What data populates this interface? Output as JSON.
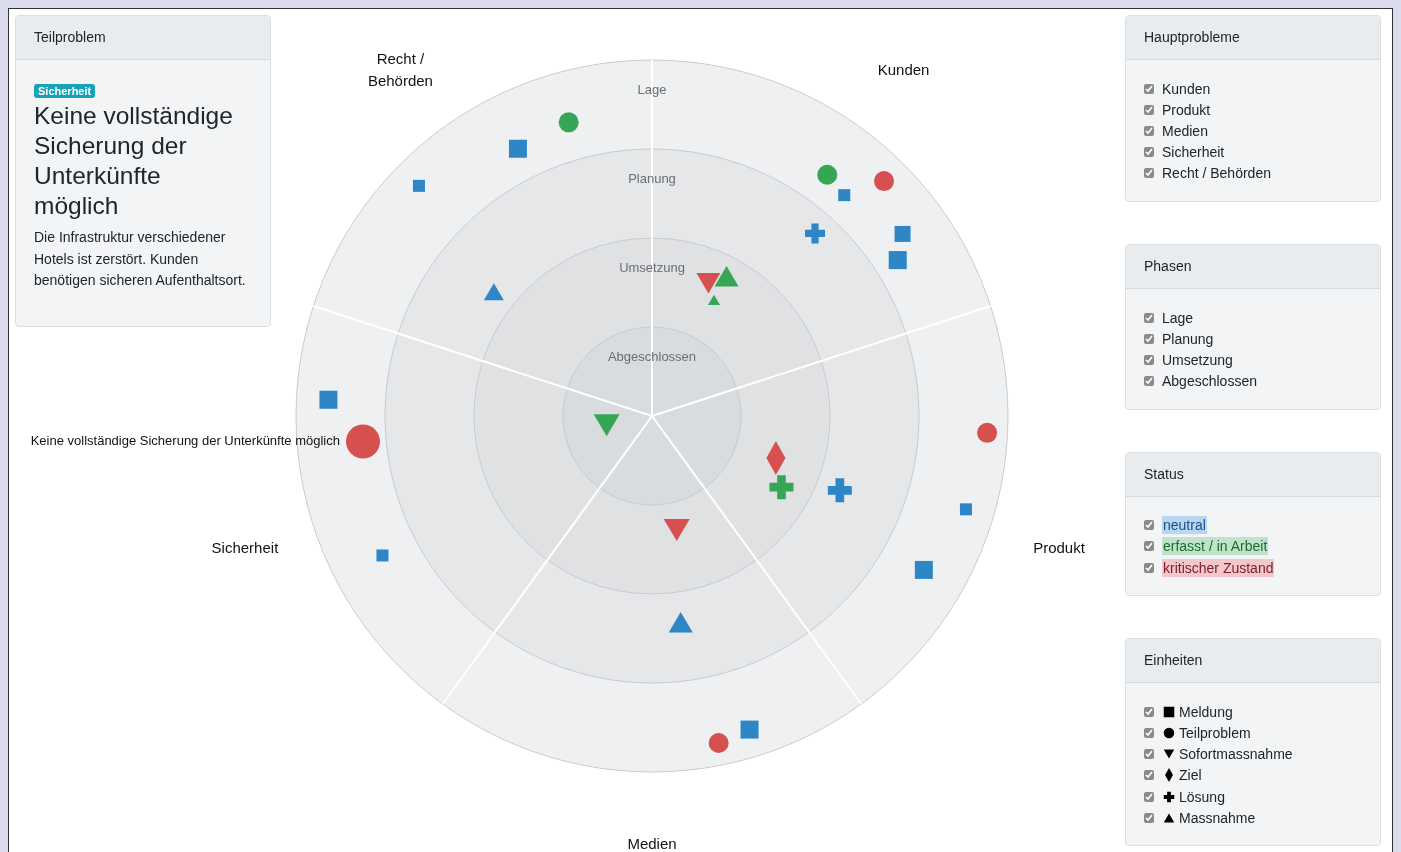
{
  "left_card": {
    "header": "Teilproblem",
    "badge": "Sicherheit",
    "title": "Keine vollständige Sicherung der Unterkünfte möglich",
    "description": "Die Infrastruktur verschiedener Hotels ist zerstört. Kunden benötigen sicheren Aufenthaltsort."
  },
  "radar": {
    "rings": [
      {
        "label": "Lage"
      },
      {
        "label": "Planung"
      },
      {
        "label": "Umsetzung"
      },
      {
        "label": "Abgeschlossen"
      }
    ],
    "sectors": [
      {
        "label": "Kunden",
        "lage": [
          {
            "kind": "circle",
            "color": "#35a655"
          },
          {
            "kind": "circle",
            "color": "#d6504f"
          },
          {
            "kind": "square",
            "color": "#2f86c6"
          },
          {
            "kind": "square",
            "color": "#2f86c6"
          },
          {
            "kind": "square",
            "color": "#2f86c6"
          }
        ],
        "planung": [
          {
            "kind": "cross",
            "color": "#2f86c6"
          }
        ],
        "umsetzung": [
          {
            "kind": "down-triangle",
            "color": "#d6504f"
          },
          {
            "kind": "triangle",
            "color": "#35a655"
          },
          {
            "kind": "triangle",
            "color": "#35a655"
          }
        ]
      },
      {
        "label": "Produkt",
        "lage": [
          {
            "kind": "circle",
            "color": "#d6504f"
          },
          {
            "kind": "square",
            "color": "#2f86c6"
          },
          {
            "kind": "square",
            "color": "#2f86c6"
          }
        ],
        "planung": [
          {
            "kind": "cross",
            "color": "#2f86c6"
          }
        ],
        "umsetzung": [
          {
            "kind": "diamond",
            "color": "#d6504f"
          },
          {
            "kind": "cross",
            "color": "#35a655"
          }
        ]
      },
      {
        "label": "Medien",
        "lage": [
          {
            "kind": "circle",
            "color": "#d6504f"
          },
          {
            "kind": "square",
            "color": "#2f86c6"
          }
        ],
        "planung": [
          {
            "kind": "triangle",
            "color": "#2f86c6"
          }
        ],
        "umsetzung": [
          {
            "kind": "down-triangle",
            "color": "#d6504f"
          }
        ]
      },
      {
        "label": "Sicherheit",
        "lage": [
          {
            "kind": "square",
            "color": "#2f86c6"
          },
          {
            "kind": "circle",
            "color": "#d6504f",
            "label": "Keine vollständige Sicherung der Unterkünfte möglich"
          },
          {
            "kind": "square",
            "color": "#2f86c6"
          }
        ],
        "abgeschlossen": [
          {
            "kind": "down-triangle",
            "color": "#35a655"
          }
        ]
      },
      {
        "label": "Recht / Behörden",
        "lage": [
          {
            "kind": "circle",
            "color": "#35a655"
          },
          {
            "kind": "square",
            "color": "#2f86c6"
          },
          {
            "kind": "square",
            "color": "#2f86c6"
          }
        ],
        "planung": [
          {
            "kind": "triangle",
            "color": "#2f86c6"
          }
        ]
      }
    ]
  },
  "filters": [
    {
      "header": "Hauptprobleme",
      "items": [
        {
          "label": "Kunden",
          "checked": true
        },
        {
          "label": "Produkt",
          "checked": true
        },
        {
          "label": "Medien",
          "checked": true
        },
        {
          "label": "Sicherheit",
          "checked": true
        },
        {
          "label": "Recht / Behörden",
          "checked": true
        }
      ]
    },
    {
      "header": "Phasen",
      "items": [
        {
          "label": "Lage",
          "checked": true
        },
        {
          "label": "Planung",
          "checked": true
        },
        {
          "label": "Umsetzung",
          "checked": true
        },
        {
          "label": "Abgeschlossen",
          "checked": true
        }
      ]
    },
    {
      "header": "Status",
      "items": [
        {
          "label": "neutral",
          "checked": true,
          "color": "#b8d7f3"
        },
        {
          "label": "erfasst / in Arbeit",
          "checked": true,
          "color": "#c0e4cb"
        },
        {
          "label": "kritischer Zustand",
          "checked": true,
          "color": "#f3c7cb"
        }
      ]
    },
    {
      "header": "Einheiten",
      "items": [
        {
          "label": "Meldung",
          "checked": true,
          "kind": "square"
        },
        {
          "label": "Teilproblem",
          "checked": true,
          "kind": "circle"
        },
        {
          "label": "Sofortmassnahme",
          "checked": true,
          "kind": "down-triangle"
        },
        {
          "label": "Ziel",
          "checked": true,
          "kind": "diamond"
        },
        {
          "label": "Lösung",
          "checked": true,
          "kind": "cross"
        },
        {
          "label": "Massnahme",
          "checked": true,
          "kind": "triangle"
        }
      ]
    }
  ]
}
